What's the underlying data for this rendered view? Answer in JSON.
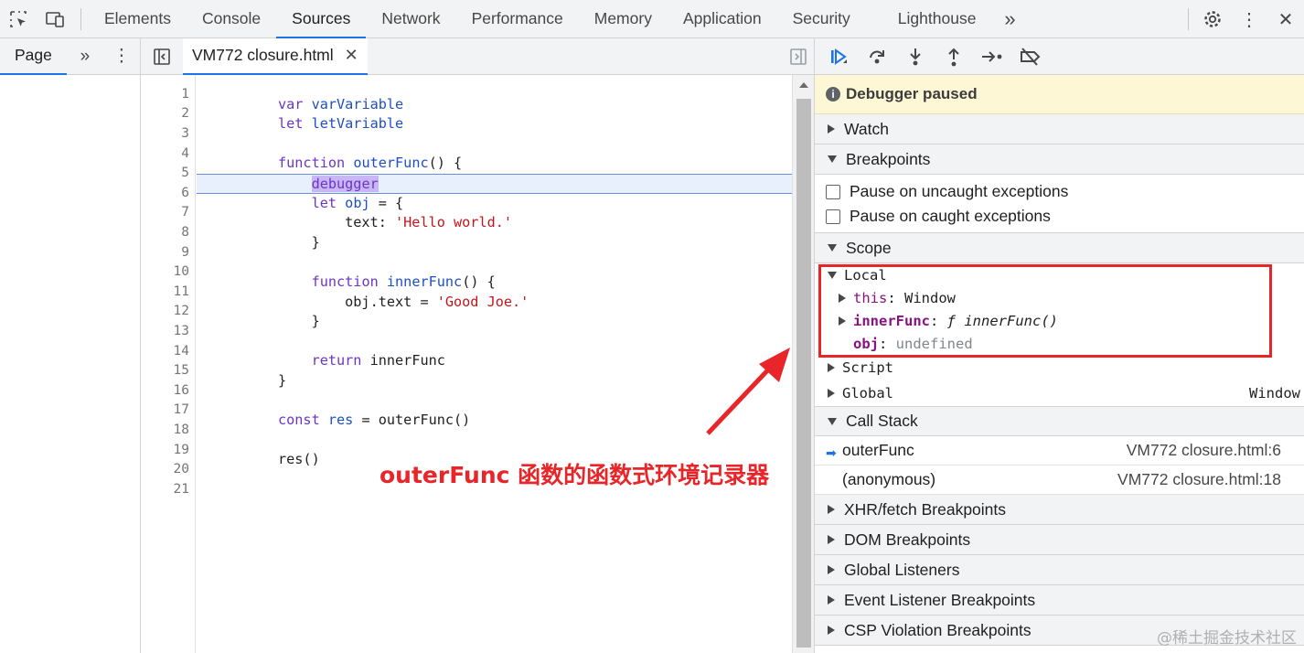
{
  "tabs": [
    "Elements",
    "Console",
    "Sources",
    "Network",
    "Performance",
    "Memory",
    "Application",
    "Security",
    "Lighthouse"
  ],
  "active_tab": "Sources",
  "navigator": {
    "tab": "Page"
  },
  "editor": {
    "file_tab": "VM772 closure.html",
    "paused_line": 6,
    "line_numbers": [
      "1",
      "2",
      "3",
      "4",
      "5",
      "6",
      "7",
      "8",
      "9",
      "10",
      "11",
      "12",
      "13",
      "14",
      "15",
      "16",
      "17",
      "18",
      "19",
      "20",
      "21"
    ]
  },
  "annotation": "outerFunc 函数的函数式环境记录器",
  "debugger": {
    "paused_label": "Debugger paused",
    "sections": {
      "watch": "Watch",
      "breakpoints": "Breakpoints",
      "scope": "Scope",
      "call_stack": "Call Stack",
      "xhr": "XHR/fetch Breakpoints",
      "dom": "DOM Breakpoints",
      "global_listeners": "Global Listeners",
      "event_listener": "Event Listener Breakpoints",
      "csp": "CSP Violation Breakpoints"
    },
    "pause_uncaught": "Pause on uncaught exceptions",
    "pause_caught": "Pause on caught exceptions",
    "scope": {
      "local": "Local",
      "this_key": "this",
      "this_value": "Window",
      "inner_key": "innerFunc",
      "inner_value": "ƒ innerFunc()",
      "obj_key": "obj",
      "obj_value": "undefined",
      "script": "Script",
      "global": "Global",
      "global_value": "Window"
    },
    "call_stack": [
      {
        "name": "outerFunc",
        "location": "VM772 closure.html:6",
        "current": true
      },
      {
        "name": "(anonymous)",
        "location": "VM772 closure.html:18",
        "current": false
      }
    ]
  },
  "watermark": "@稀土掘金技术社区",
  "colors": {
    "accent": "#1a73e8",
    "annotation": "#e8262a",
    "paused_bg": "#fdf7d6",
    "line_highlight": "#e8f0fe"
  },
  "icons": [
    "inspect-icon",
    "device-toggle-icon",
    "more-tabs-icon",
    "settings-icon",
    "kebab-menu-icon",
    "close-icon",
    "toggle-navigator-icon",
    "resume-icon",
    "step-over-icon",
    "step-into-icon",
    "step-out-icon",
    "step-icon",
    "deactivate-breakpoints-icon"
  ]
}
